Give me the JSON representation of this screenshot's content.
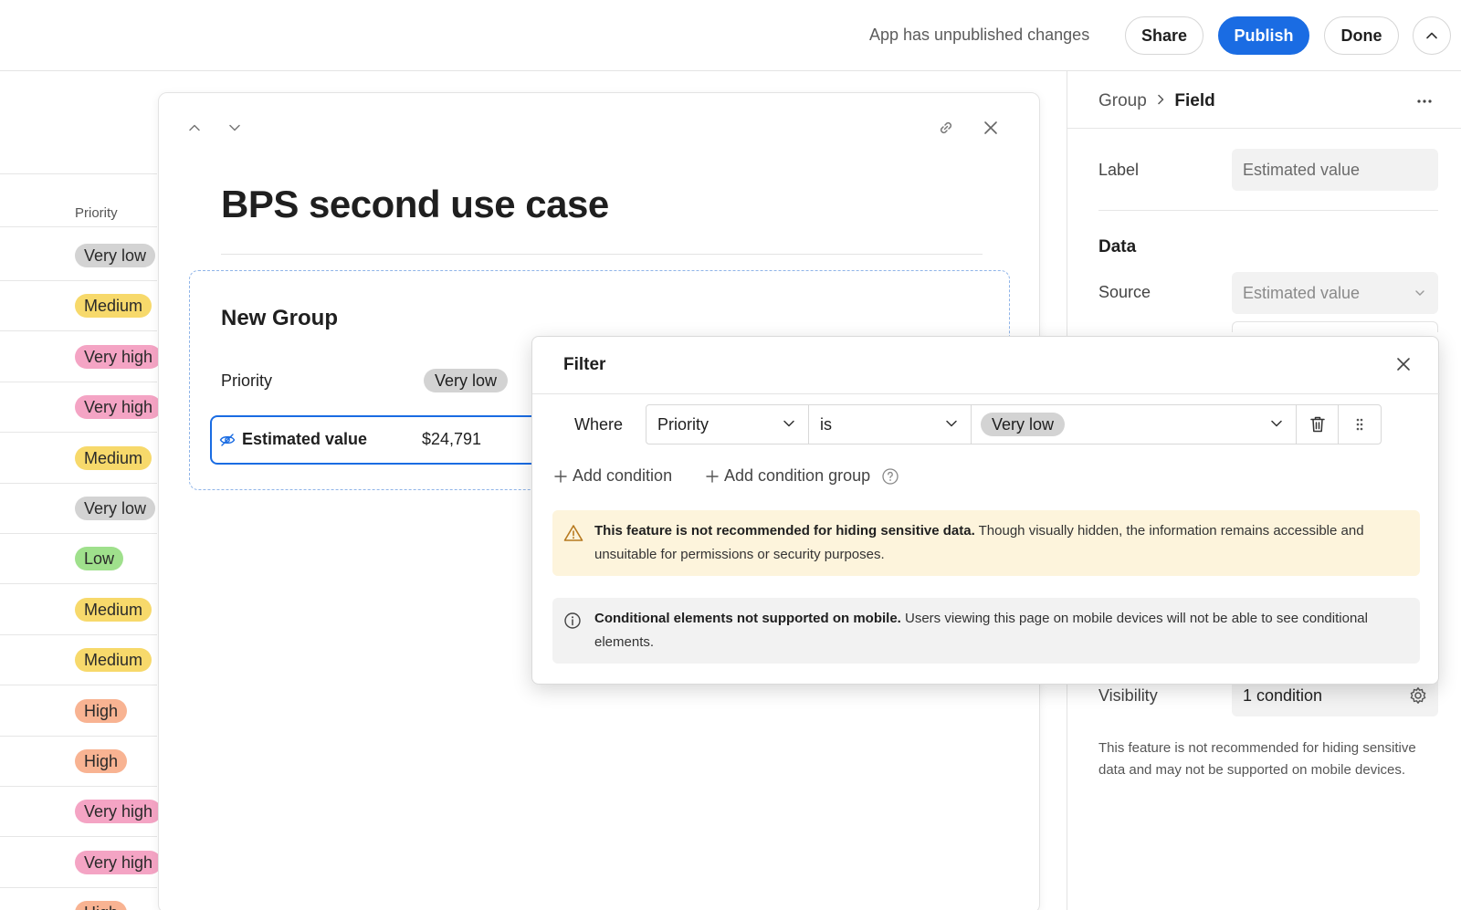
{
  "topbar": {
    "unpublished_text": "App has unpublished changes",
    "share_label": "Share",
    "publish_label": "Publish",
    "done_label": "Done"
  },
  "list": {
    "column_header": "Priority",
    "rows": [
      {
        "label": "Very low",
        "kind": "verylow"
      },
      {
        "label": "Medium",
        "kind": "medium"
      },
      {
        "label": "Very high",
        "kind": "veryhigh"
      },
      {
        "label": "Very high",
        "kind": "veryhigh"
      },
      {
        "label": "Medium",
        "kind": "medium"
      },
      {
        "label": "Very low",
        "kind": "verylow"
      },
      {
        "label": "Low",
        "kind": "low"
      },
      {
        "label": "Medium",
        "kind": "medium"
      },
      {
        "label": "Medium",
        "kind": "medium"
      },
      {
        "label": "High",
        "kind": "high"
      },
      {
        "label": "High",
        "kind": "high"
      },
      {
        "label": "Very high",
        "kind": "veryhigh"
      },
      {
        "label": "Very high",
        "kind": "veryhigh"
      },
      {
        "label": "High",
        "kind": "high"
      }
    ]
  },
  "record": {
    "title": "BPS second use case",
    "group_title": "New Group",
    "priority_label": "Priority",
    "priority_value": "Very low",
    "estimated_label": "Estimated value",
    "estimated_value": "$24,791"
  },
  "panel": {
    "crumb_parent": "Group",
    "crumb_current": "Field",
    "label_label": "Label",
    "label_value": "Estimated value",
    "data_heading": "Data",
    "source_label": "Source",
    "source_value": "Estimated value",
    "visibility_label": "Visibility",
    "visibility_value": "1 condition",
    "visibility_note": "This feature is not recommended for hiding sensitive data and may not be supported on mobile devices."
  },
  "filter": {
    "title": "Filter",
    "where_label": "Where",
    "field_value": "Priority",
    "operator_value": "is",
    "value_chip": "Very low",
    "add_condition": "Add condition",
    "add_condition_group": "Add condition group",
    "warning_bold": "This feature is not recommended for hiding sensitive data.",
    "warning_text": " Though visually hidden, the information remains accessible and unsuitable for permissions or security purposes.",
    "info_bold": "Conditional elements not supported on mobile.",
    "info_text": " Users viewing this page on mobile devices will not be able to see conditional elements."
  },
  "colors": {
    "accent": "#1a6ce3",
    "warning_bg": "#fdf4dc",
    "info_bg": "#f2f2f2"
  }
}
